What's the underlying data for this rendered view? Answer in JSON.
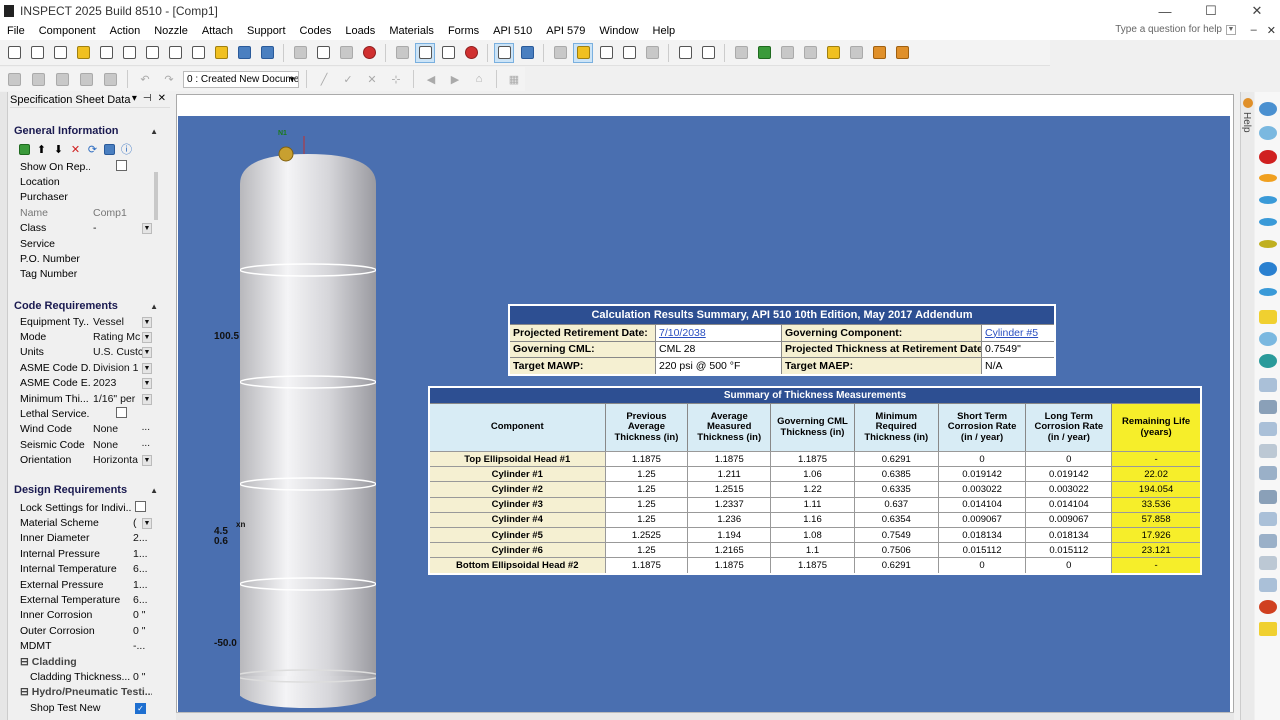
{
  "window": {
    "title": "INSPECT 2025 Build 8510 - [Comp1]",
    "minimize": "—",
    "maximize": "☐",
    "close": "✕"
  },
  "menu": {
    "items": [
      "File",
      "Component",
      "Action",
      "Nozzle",
      "Attach",
      "Support",
      "Codes",
      "Loads",
      "Materials",
      "Forms",
      "API 510",
      "API 579",
      "Window",
      "Help"
    ],
    "help_placeholder": "Type a question for help"
  },
  "toolbar2": {
    "document_select": "0 : Created New Docume"
  },
  "left_panel": {
    "title": "Specification Sheet Data",
    "sections": {
      "general": {
        "title": "General Information",
        "rows": [
          {
            "label": "Show On Rep...",
            "value": ""
          },
          {
            "label": "Location",
            "value": ""
          },
          {
            "label": "Purchaser",
            "value": ""
          },
          {
            "label": "Name",
            "value": "Comp1"
          },
          {
            "label": "Class",
            "value": "-"
          },
          {
            "label": "Service",
            "value": ""
          },
          {
            "label": "P.O. Number",
            "value": ""
          },
          {
            "label": "Tag Number",
            "value": ""
          }
        ]
      },
      "code": {
        "title": "Code Requirements",
        "rows": [
          {
            "label": "Equipment Ty...",
            "value": "Vessel"
          },
          {
            "label": "Mode",
            "value": "Rating Mc"
          },
          {
            "label": "Units",
            "value": "U.S. Custc"
          },
          {
            "label": "ASME Code D...",
            "value": "Division 1"
          },
          {
            "label": "ASME Code E...",
            "value": "2023"
          },
          {
            "label": "Minimum Thi...",
            "value": "1/16\" per"
          },
          {
            "label": "Lethal Service...",
            "value": ""
          },
          {
            "label": "Wind Code",
            "value": "None"
          },
          {
            "label": "Seismic Code",
            "value": "None"
          },
          {
            "label": "Orientation",
            "value": "Horizonta"
          }
        ]
      },
      "design": {
        "title": "Design Requirements",
        "rows": [
          {
            "label": "Lock Settings for Indivi...",
            "value": ""
          },
          {
            "label": "Material Scheme",
            "value": "("
          },
          {
            "label": "Inner Diameter",
            "value": "2..."
          },
          {
            "label": "Internal Pressure",
            "value": "1..."
          },
          {
            "label": "Internal Temperature",
            "value": "6..."
          },
          {
            "label": "External Pressure",
            "value": "1..."
          },
          {
            "label": "External Temperature",
            "value": "6..."
          },
          {
            "label": "Inner Corrosion",
            "value": "0 \""
          },
          {
            "label": "Outer Corrosion",
            "value": "0 \""
          },
          {
            "label": "MDMT",
            "value": "-..."
          },
          {
            "label": "Cladding",
            "value": ""
          },
          {
            "label": "Cladding Thickness...",
            "value": "0 \""
          },
          {
            "label": "Hydro/Pneumatic Testi...",
            "value": ""
          },
          {
            "label": "Shop Test New",
            "value": ""
          }
        ]
      }
    }
  },
  "vessel_labels": {
    "dim_top": "100.5",
    "dim_mid_a": "4.5",
    "dim_mid_b": "0.6",
    "dim_mid_c": "xn",
    "dim_bottom": "-50.0",
    "nozzle_tag": "N1"
  },
  "calc_results": {
    "title": "Calculation Results Summary, API 510 10th Edition, May 2017 Addendum",
    "rows": [
      {
        "l1": "Projected Retirement Date:",
        "v1": "7/10/2038",
        "l2": "Governing Component:",
        "v2": "Cylinder #5"
      },
      {
        "l1": "Governing CML:",
        "v1": "CML 28",
        "l2": "Projected Thickness at Retirement Date:",
        "v2": "0.7549\""
      },
      {
        "l1": "Target MAWP:",
        "v1": "220 psi @ 500 °F",
        "l2": "Target MAEP:",
        "v2": "N/A"
      }
    ]
  },
  "thickness_summary": {
    "title": "Summary of Thickness Measurements",
    "headers": [
      "Component",
      "Previous Average Thickness (in)",
      "Average Measured Thickness (in)",
      "Governing CML Thickness (in)",
      "Minimum Required Thickness (in)",
      "Short Term Corrosion Rate (in / year)",
      "Long Term Corrosion Rate (in / year)",
      "Remaining Life (years)"
    ],
    "rows": [
      [
        "Top Ellipsoidal Head #1",
        "1.1875",
        "1.1875",
        "1.1875",
        "0.6291",
        "0",
        "0",
        "-"
      ],
      [
        "Cylinder #1",
        "1.25",
        "1.211",
        "1.06",
        "0.6385",
        "0.019142",
        "0.019142",
        "22.02"
      ],
      [
        "Cylinder #2",
        "1.25",
        "1.2515",
        "1.22",
        "0.6335",
        "0.003022",
        "0.003022",
        "194.054"
      ],
      [
        "Cylinder #3",
        "1.25",
        "1.2337",
        "1.11",
        "0.637",
        "0.014104",
        "0.014104",
        "33.536"
      ],
      [
        "Cylinder #4",
        "1.25",
        "1.236",
        "1.16",
        "0.6354",
        "0.009067",
        "0.009067",
        "57.858"
      ],
      [
        "Cylinder #5",
        "1.2525",
        "1.194",
        "1.08",
        "0.7549",
        "0.018134",
        "0.018134",
        "17.926"
      ],
      [
        "Cylinder #6",
        "1.25",
        "1.2165",
        "1.1",
        "0.7506",
        "0.015112",
        "0.015112",
        "23.121"
      ],
      [
        "Bottom Ellipsoidal Head #2",
        "1.1875",
        "1.1875",
        "1.1875",
        "0.6291",
        "0",
        "0",
        "-"
      ]
    ]
  },
  "right_panel": {
    "help_tab": "Help"
  },
  "colors": {
    "viewport_bg": "#4a6fb0",
    "table_header_bg": "#2d4f92",
    "label_bg": "#f5f0d2",
    "remaining_life_bg": "#f6ee2a",
    "column_header_bg": "#d8ecf5"
  }
}
